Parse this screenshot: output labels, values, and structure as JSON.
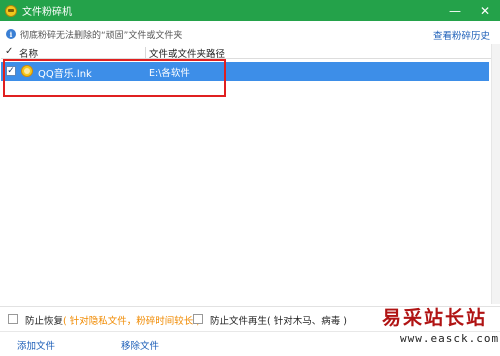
{
  "window": {
    "title": "文件粉碎机",
    "minimize": "—",
    "close": "✕"
  },
  "info": {
    "text": "彻底粉碎无法删除的“顽固”文件或文件夹",
    "history_link": "查看粉碎历史"
  },
  "table": {
    "columns": [
      "名称",
      "文件或文件夹路径"
    ],
    "rows": [
      {
        "checked": true,
        "name": "QQ音乐.lnk",
        "path": "E:\\各软件"
      }
    ]
  },
  "options": {
    "prevent_recover": "防止恢复",
    "prevent_recover_hint": "( 针对隐私文件，粉碎时间较长 )",
    "prevent_regen": "防止文件再生",
    "prevent_regen_hint": "( 针对木马、病毒 )"
  },
  "actions": {
    "add_file": "添加文件",
    "remove_file": "移除文件"
  },
  "watermark": {
    "cn": "易采站长站",
    "url": "www.easck.com"
  },
  "colors": {
    "titlebar": "#24a24a",
    "selected_row": "#3d8ee8",
    "highlight_box": "#e02020",
    "link": "#1d5fb8",
    "hint": "#f08a00"
  }
}
